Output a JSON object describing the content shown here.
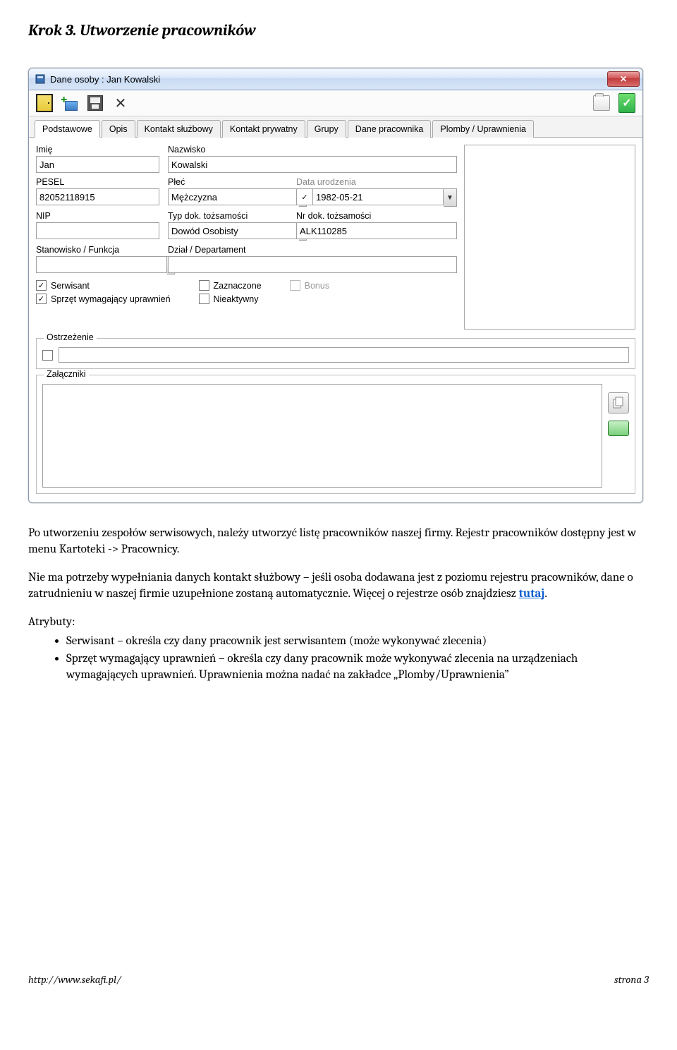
{
  "step_title": "Krok 3. Utworzenie pracowników",
  "window": {
    "title": "Dane osoby : Jan Kowalski",
    "tabs": [
      "Podstawowe",
      "Opis",
      "Kontakt służbowy",
      "Kontakt prywatny",
      "Grupy",
      "Dane pracownika",
      "Plomby / Uprawnienia"
    ],
    "active_tab": 0,
    "fields": {
      "imie_label": "Imię",
      "imie_value": "Jan",
      "nazwisko_label": "Nazwisko",
      "nazwisko_value": "Kowalski",
      "pesel_label": "PESEL",
      "pesel_value": "82052118915",
      "plec_label": "Płeć",
      "plec_value": "Mężczyzna",
      "data_ur_label": "Data urodzenia",
      "data_ur_value": "1982-05-21",
      "nip_label": "NIP",
      "nip_value": "",
      "typ_dok_label": "Typ dok. tożsamości",
      "typ_dok_value": "Dowód Osobisty",
      "nr_dok_label": "Nr dok. tożsamości",
      "nr_dok_value": "ALK110285",
      "stanowisko_label": "Stanowisko / Funkcja",
      "stanowisko_value": "",
      "dzial_label": "Dział / Departament",
      "dzial_value": ""
    },
    "checks": {
      "serwisant": "Serwisant",
      "sprzet": "Sprzęt wymagający uprawnień",
      "zaznaczone": "Zaznaczone",
      "nieaktywny": "Nieaktywny",
      "bonus": "Bonus"
    },
    "group_ostrzezenie": "Ostrzeżenie",
    "group_zalaczniki": "Załączniki"
  },
  "body": {
    "p1": "Po utworzeniu zespołów serwisowych, należy utworzyć listę pracowników naszej firmy. Rejestr pracowników dostępny jest w menu Kartoteki -> Pracownicy.",
    "p2a": "Nie ma potrzeby wypełniania danych kontakt służbowy – jeśli osoba dodawana jest z poziomu rejestru pracowników, dane o zatrudnieniu w naszej firmie uzupełnione zostaną automatycznie. Więcej o rejestrze osób znajdziesz ",
    "p2link": "tutaj",
    "p2b": ".",
    "attrs_label": "Atrybuty:",
    "bullet1": "Serwisant – określa czy dany pracownik jest serwisantem (może wykonywać zlecenia)",
    "bullet2": "Sprzęt wymagający uprawnień – określa czy dany pracownik może wykonywać zlecenia na urządzeniach wymagających uprawnień. Uprawnienia można nadać na zakładce „Plomby/Uprawnienia”"
  },
  "footer": {
    "left": "http://www.sekafi.pl/",
    "right": "strona 3"
  }
}
